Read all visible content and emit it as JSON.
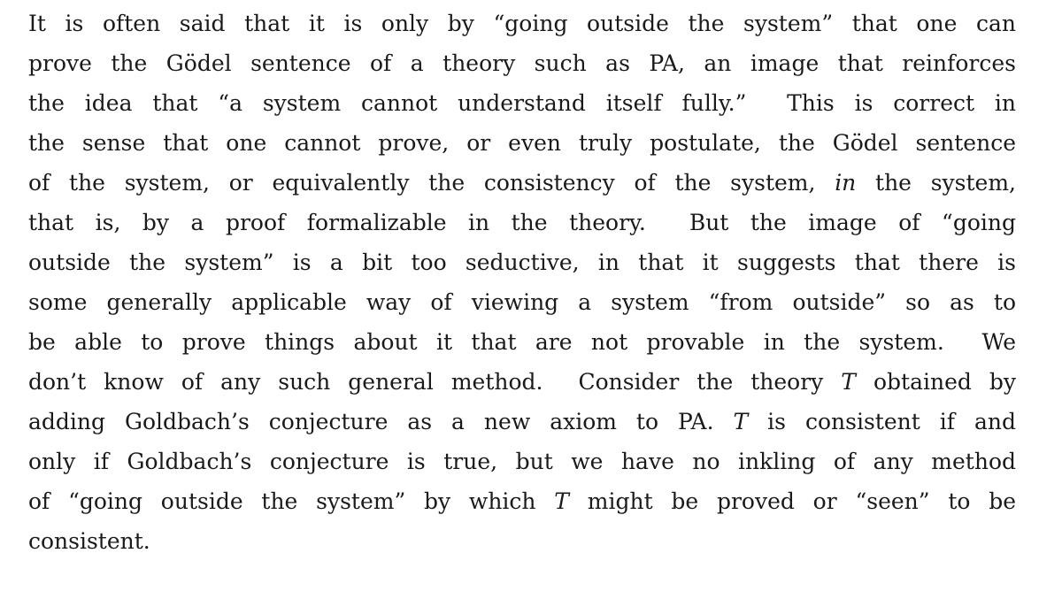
{
  "paragraph": {
    "lines": [
      [
        {
          "t": "It is often said that it is only by “going outside the system” that one can"
        }
      ],
      [
        {
          "t": "prove the Gödel sentence of a theory such as PA, an image that reinforces"
        }
      ],
      [
        {
          "t": "the idea that “a system cannot understand itself fully.”  This is correct in"
        }
      ],
      [
        {
          "t": "the sense that one cannot prove, or even truly postulate, the Gödel sentence"
        }
      ],
      [
        {
          "t": "of the system, or equivalently the consistency of the system, "
        },
        {
          "t": "in",
          "i": true
        },
        {
          "t": " the system,"
        }
      ],
      [
        {
          "t": "that is, by a proof formalizable in the theory.  But the image of “going"
        }
      ],
      [
        {
          "t": "outside the system” is a bit too seductive, in that it suggests that there is"
        }
      ],
      [
        {
          "t": "some generally applicable way of viewing a system “from outside” so as to"
        }
      ],
      [
        {
          "t": "be able to prove things about it that are not provable in the system.  We"
        }
      ],
      [
        {
          "t": "don’t know of any such general method.  Consider the theory "
        },
        {
          "t": "T",
          "i": true
        },
        {
          "t": " obtained by"
        }
      ],
      [
        {
          "t": "adding Goldbach’s conjecture as a new axiom to PA. "
        },
        {
          "t": "T",
          "i": true
        },
        {
          "t": " is consistent if and"
        }
      ],
      [
        {
          "t": "only if Goldbach’s conjecture is true, but we have no inkling of any method"
        }
      ],
      [
        {
          "t": "of “going outside the system” by which "
        },
        {
          "t": "T",
          "i": true
        },
        {
          "t": " might be proved or “seen” to be"
        }
      ],
      [
        {
          "t": "consistent."
        }
      ]
    ]
  }
}
